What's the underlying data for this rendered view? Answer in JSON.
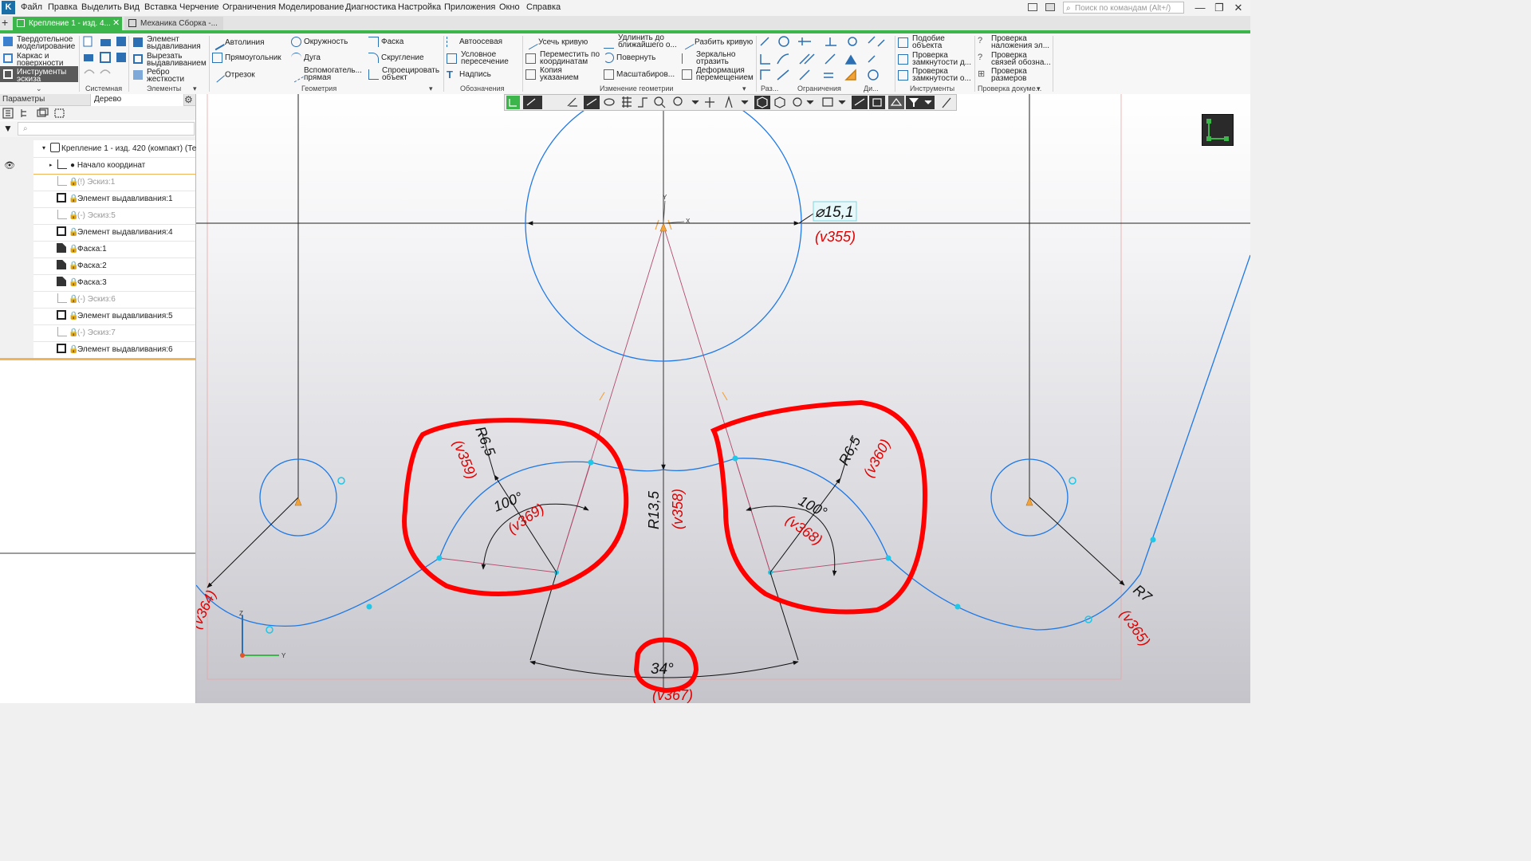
{
  "menubar": {
    "items": [
      "Файл",
      "Правка",
      "Выделить",
      "Вид",
      "Вставка",
      "Черчение",
      "Ограничения",
      "Моделирование",
      "Диагностика",
      "Настройка",
      "Приложения",
      "Окно",
      "Справка"
    ],
    "search_placeholder": "Поиск по командам (Alt+/)"
  },
  "tabs": [
    {
      "label": "Крепление 1 - изд. 4...",
      "active": true
    },
    {
      "label": "Механика Сборка -...",
      "active": false
    }
  ],
  "ribbon": {
    "modes": [
      "Твердотельное моделирование",
      "Каркас и поверхности",
      "Инструменты эскиза"
    ],
    "elements": [
      "Элемент выдавливания",
      "Вырезать выдавливанием",
      "Ребро жесткости"
    ],
    "geometry_col1": [
      "Автолиния",
      "Прямоугольник",
      "Отрезок"
    ],
    "geometry_col2": [
      "Окружность",
      "Дуга",
      "Вспомогатель... прямая"
    ],
    "geometry_col3": [
      "Фаска",
      "Скругление",
      "Спроецировать объект"
    ],
    "annotations": [
      "Автоосевая",
      "Условное пересечение",
      "Надпись"
    ],
    "edit_col1": [
      "Усечь кривую",
      "Переместить по координатам",
      "Копия указанием"
    ],
    "edit_col2": [
      "Удлинить до ближайшего о...",
      "Повернуть",
      "Масштабиров..."
    ],
    "edit_col3": [
      "Разбить кривую",
      "Зеркально отразить",
      "Деформация перемещением"
    ],
    "tools": [
      "Подобие объекта",
      "Проверка замкнутости д...",
      "Проверка замкнутости о..."
    ],
    "doc_check": [
      "Проверка наложения эл...",
      "Проверка связей обозна...",
      "Проверка размеров"
    ],
    "group_labels": [
      "Системная",
      "Элементы",
      "Геометрия",
      "Обозначения",
      "Изменение геометрии",
      "Раз...",
      "Ограничения",
      "Ди...",
      "Инструменты",
      "Проверка докуме..."
    ]
  },
  "panel": {
    "tabs": [
      "Параметры",
      "Дерево"
    ],
    "tree": [
      {
        "label": "Крепление 1 - изд. 420 (компакт) (Тел",
        "dim": false
      },
      {
        "label": "Начало координат",
        "dim": false
      },
      {
        "label": "(!) Эскиз:1",
        "dim": true
      },
      {
        "label": "Элемент выдавливания:1",
        "dim": false
      },
      {
        "label": "(-) Эскиз:5",
        "dim": true
      },
      {
        "label": "Элемент выдавливания:4",
        "dim": false
      },
      {
        "label": "Фаска:1",
        "dim": false
      },
      {
        "label": "Фаска:2",
        "dim": false
      },
      {
        "label": "Фаска:3",
        "dim": false
      },
      {
        "label": "(-) Эскиз:6",
        "dim": true
      },
      {
        "label": "Элемент выдавливания:5",
        "dim": false
      },
      {
        "label": "(-) Эскиз:7",
        "dim": true
      },
      {
        "label": "Элемент выдавливания:6",
        "dim": false
      }
    ]
  },
  "sketch": {
    "dimensions": {
      "diameter": "⌀15,1",
      "diameter_var": "(v355)",
      "r_center": "R13,5",
      "r_center_var": "(v358)",
      "r_left": "R6,5",
      "r_left_var": "(v359)",
      "r_right": "R6,5",
      "r_right_var": "(v360)",
      "ang_left": "100°",
      "ang_left_var": "(v369)",
      "ang_right": "100°",
      "ang_right_var": "(v368)",
      "ang_bottom": "34°",
      "ang_bottom_var": "(v367)",
      "r_far_right": "R7",
      "r_far_right_var": "(v365)",
      "r_far_left_var": "(v364)"
    },
    "axis_labels": {
      "x": "X",
      "y": "Y",
      "z": "Z"
    }
  },
  "colors": {
    "accent": "#3cb54a",
    "sketch": "#1e78e6",
    "dimension": "#e00000",
    "annotation": "#ff0000"
  }
}
